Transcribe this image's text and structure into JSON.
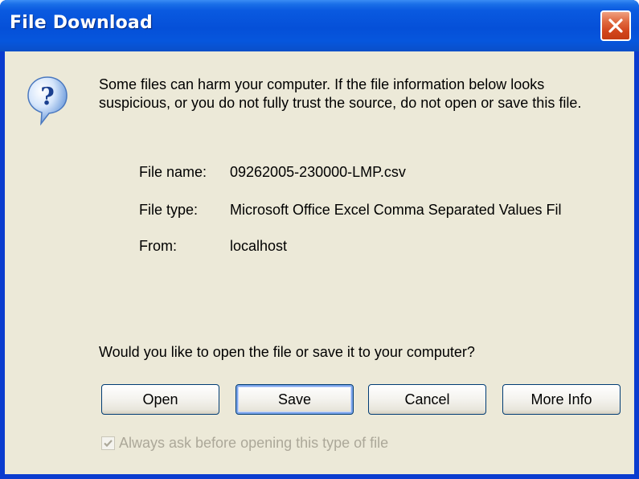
{
  "window": {
    "title": "File Download"
  },
  "icons": {
    "dialog": "question-icon",
    "close": "close-icon"
  },
  "message": {
    "warning": "Some files can harm your computer. If the file information below looks suspicious, or you do not fully trust the source, do not open or save this file.",
    "question": "Would you like to open the file or save it to your computer?"
  },
  "file_info": {
    "name_label": "File name:",
    "name_value": "09262005-230000-LMP.csv",
    "type_label": "File type:",
    "type_value": "Microsoft Office Excel Comma Separated Values Fil",
    "from_label": "From:",
    "from_value": "localhost"
  },
  "buttons": {
    "open": "Open",
    "save": "Save",
    "cancel": "Cancel",
    "more_info": "More Info"
  },
  "checkbox": {
    "label": "Always ask before opening this type of file",
    "checked": true,
    "enabled": false
  },
  "colors": {
    "titlebar": "#0550d8",
    "client_bg": "#ece9d8",
    "close_button": "#d2451c",
    "disabled_text": "#aca899"
  }
}
